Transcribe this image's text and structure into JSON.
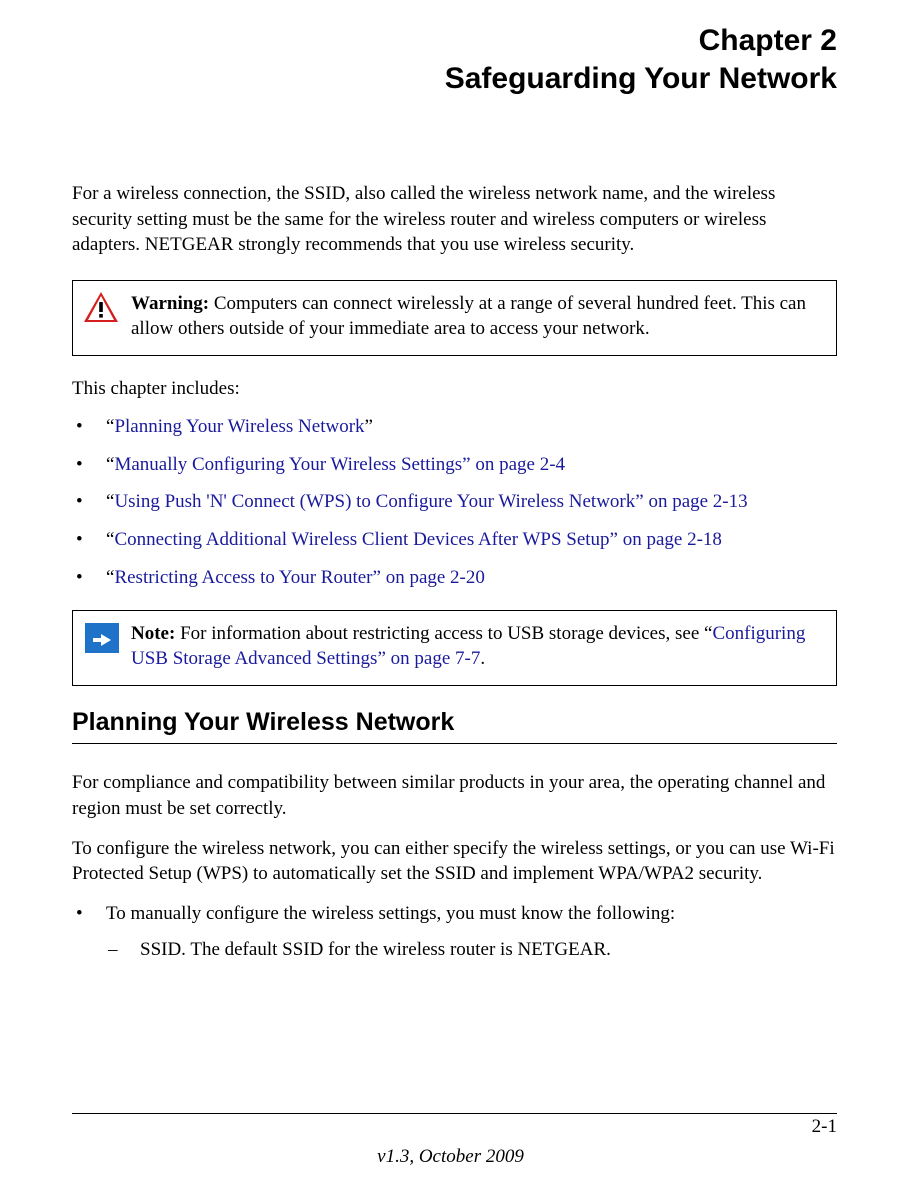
{
  "chapter": {
    "number_line": "Chapter 2",
    "title": "Safeguarding Your Network"
  },
  "intro": "For a wireless connection, the SSID, also called the wireless network name, and the wireless security setting must be the same for the wireless router and wireless computers or wireless adapters. NETGEAR strongly recommends that you use wireless security.",
  "warning": {
    "label": "Warning:",
    "text": " Computers can connect wirelessly at a range of several hundred feet. This can allow others outside of your immediate area to access your network."
  },
  "toc_intro": "This chapter includes:",
  "toc": [
    {
      "prefix": "“",
      "link": "Planning Your Wireless Network",
      "suffix": "”"
    },
    {
      "prefix": "“",
      "link": "Manually Configuring Your Wireless Settings” on page 2-4",
      "suffix": ""
    },
    {
      "prefix": "“",
      "link": "Using Push 'N' Connect (WPS) to Configure Your Wireless Network” on page 2-13",
      "suffix": ""
    },
    {
      "prefix": "“",
      "link": "Connecting Additional Wireless Client Devices After WPS Setup” on page 2-18",
      "suffix": ""
    },
    {
      "prefix": "“",
      "link": "Restricting Access to Your Router” on page 2-20",
      "suffix": ""
    }
  ],
  "note": {
    "label": "Note:",
    "text_before": " For information about restricting access to USB storage devices, see “",
    "link": "Configuring USB Storage Advanced Settings” on page 7-7",
    "text_after": "."
  },
  "section_title": "Planning Your Wireless Network",
  "body": {
    "p1": "For compliance and compatibility between similar products in your area, the operating channel and region must be set correctly.",
    "p2": "To configure the wireless network, you can either specify the wireless settings, or you can use Wi-Fi Protected Setup (WPS) to automatically set the SSID and implement WPA/WPA2 security.",
    "b1": "To manually configure the wireless settings, you must know the following:",
    "b1_1": "SSID. The default SSID for the wireless router is NETGEAR."
  },
  "footer": {
    "page": "2-1",
    "version": "v1.3, October 2009"
  }
}
